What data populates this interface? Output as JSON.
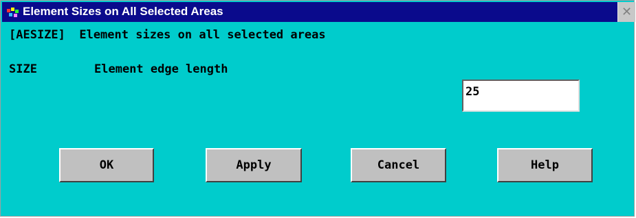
{
  "window": {
    "title": "Element Sizes on All Selected Areas",
    "close_glyph": "✕"
  },
  "content": {
    "command_line": "[AESIZE]  Element sizes on all selected areas",
    "size_code": "SIZE",
    "size_description": "Element edge length",
    "size_value": "25"
  },
  "buttons": {
    "ok": "OK",
    "apply": "Apply",
    "cancel": "Cancel",
    "help": "Help"
  },
  "colors": {
    "background": "#00cccc",
    "titlebar": "#0a0a8c",
    "button": "#c0c0c0"
  }
}
